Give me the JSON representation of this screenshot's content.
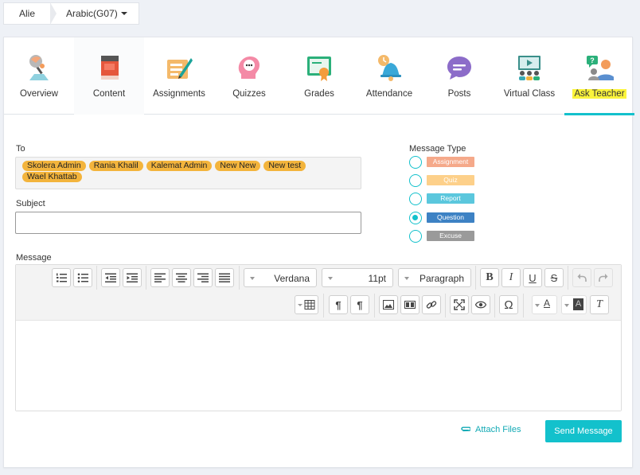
{
  "breadcrumb": {
    "user": "Alie",
    "course": "Arabic(G07)"
  },
  "tabs": [
    {
      "label": "Overview",
      "icon": "overview-icon"
    },
    {
      "label": "Content",
      "icon": "book-icon"
    },
    {
      "label": "Assignments",
      "icon": "assignment-icon"
    },
    {
      "label": "Quizzes",
      "icon": "quiz-icon"
    },
    {
      "label": "Grades",
      "icon": "certificate-icon"
    },
    {
      "label": "Attendance",
      "icon": "bell-icon"
    },
    {
      "label": "Posts",
      "icon": "chat-icon"
    },
    {
      "label": "Virtual Class",
      "icon": "virtual-class-icon"
    },
    {
      "label": "Ask Teacher",
      "icon": "ask-teacher-icon"
    }
  ],
  "active_tab": "Ask Teacher",
  "form": {
    "to_label": "To",
    "recipients": [
      "Skolera Admin",
      "Rania Khalil",
      "Kalemat Admin",
      "New New",
      "New test",
      "Wael Khattab"
    ],
    "subject_label": "Subject",
    "subject_value": "",
    "message_label": "Message",
    "message_type_label": "Message Type",
    "message_types": [
      {
        "label": "Assignment",
        "color": "#f5a98a",
        "selected": false
      },
      {
        "label": "Quiz",
        "color": "#fdd08a",
        "selected": false
      },
      {
        "label": "Report",
        "color": "#5bc7dd",
        "selected": false
      },
      {
        "label": "Question",
        "color": "#3d82c4",
        "selected": true
      },
      {
        "label": "Excuse",
        "color": "#9a9a9a",
        "selected": false
      }
    ]
  },
  "editor": {
    "font_family": "Verdana",
    "font_size": "11pt",
    "block_format": "Paragraph",
    "toolbar_glyphs": {
      "bold": "B",
      "italic": "I",
      "underline": "U",
      "strike": "S",
      "omega": "Ω",
      "text_color": "A",
      "bg_color": "A",
      "clear": "T",
      "ltr": "¶",
      "rtl": "¶"
    }
  },
  "actions": {
    "attach": "Attach Files",
    "send": "Send Message"
  },
  "colors": {
    "accent": "#13c1cc",
    "highlight": "#fbf43c",
    "chip": "#f3b43c"
  }
}
